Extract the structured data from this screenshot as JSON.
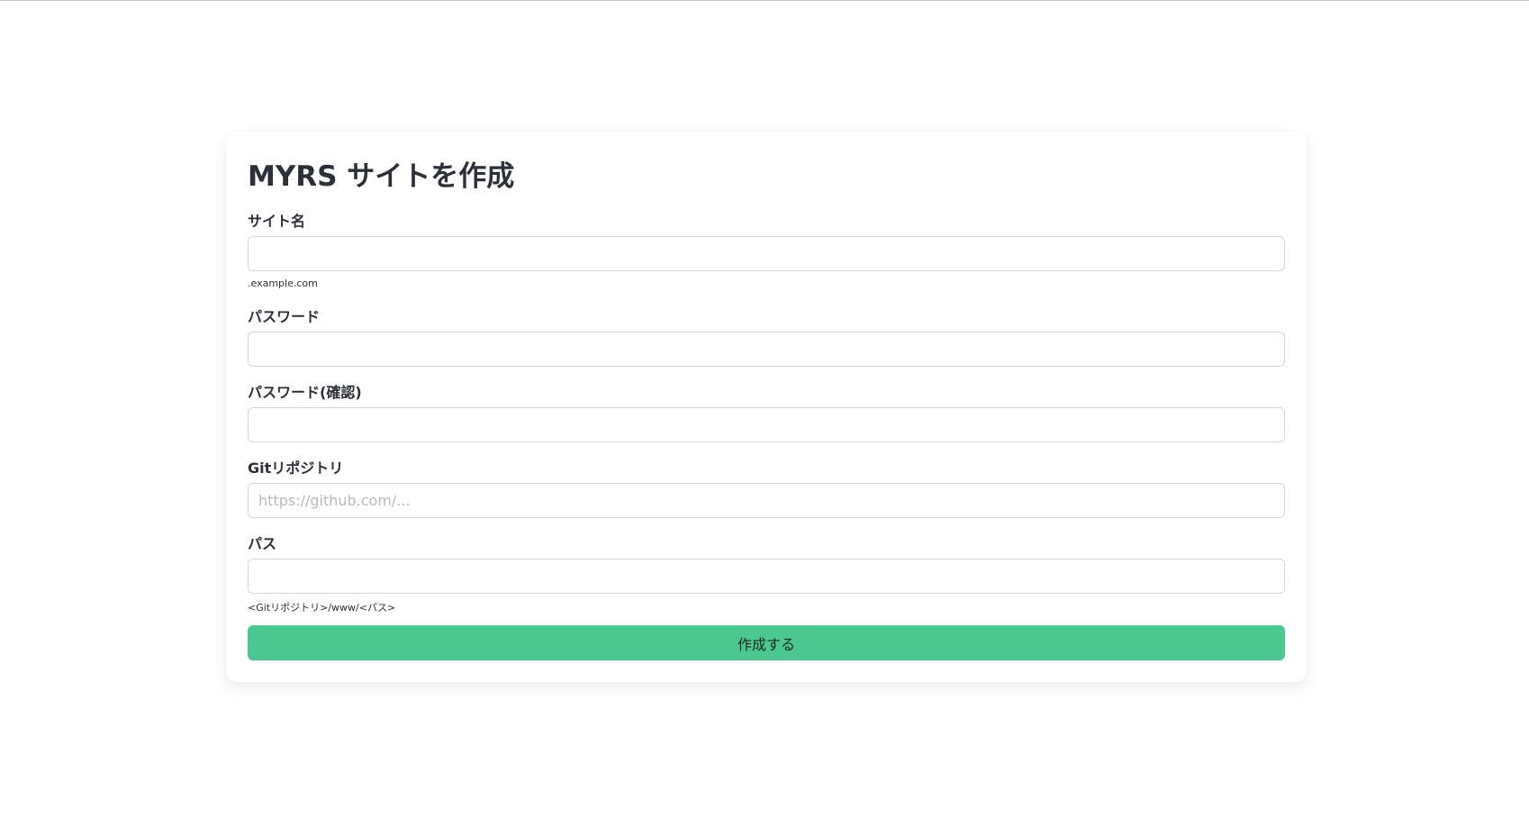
{
  "form": {
    "title": "MYRS サイトを作成",
    "site_name": {
      "label": "サイト名",
      "value": "",
      "placeholder": "",
      "hint": ".example.com"
    },
    "password": {
      "label": "パスワード",
      "value": "",
      "placeholder": ""
    },
    "password_confirm": {
      "label": "パスワード(確認)",
      "value": "",
      "placeholder": ""
    },
    "git_repo": {
      "label": "Gitリポジトリ",
      "value": "",
      "placeholder": "https://github.com/..."
    },
    "path": {
      "label": "パス",
      "value": "",
      "placeholder": "",
      "hint": "<Gitリポジトリ>/www/<パス>"
    },
    "submit_label": "作成する"
  },
  "colors": {
    "accent": "#4bc88f",
    "text": "#2d3039",
    "border": "#d6d6df"
  }
}
